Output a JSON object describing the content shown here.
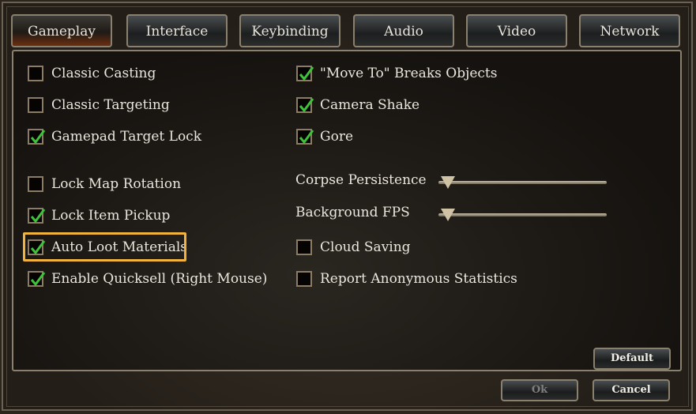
{
  "tabs": [
    {
      "label": "Gameplay",
      "active": true
    },
    {
      "label": "Interface"
    },
    {
      "label": "Keybinding"
    },
    {
      "label": "Audio"
    },
    {
      "label": "Video"
    },
    {
      "label": "Network"
    }
  ],
  "left_options": [
    {
      "label": "Classic Casting",
      "checked": false
    },
    {
      "label": "Classic Targeting",
      "checked": false
    },
    {
      "label": "Gamepad Target Lock",
      "checked": true
    },
    {
      "label": "Lock Map Rotation",
      "checked": false
    },
    {
      "label": "Lock Item Pickup",
      "checked": true
    },
    {
      "label": "Auto Loot Materials",
      "checked": true,
      "highlighted": true
    },
    {
      "label": "Enable Quicksell (Right Mouse)",
      "checked": true
    }
  ],
  "right_options": [
    {
      "label": "\"Move To\" Breaks Objects",
      "checked": true
    },
    {
      "label": "Camera Shake",
      "checked": true
    },
    {
      "label": "Gore",
      "checked": true
    },
    {
      "label": "Cloud Saving",
      "checked": false
    },
    {
      "label": "Report Anonymous Statistics",
      "checked": false
    }
  ],
  "sliders": [
    {
      "label": "Corpse Persistence",
      "value_percent": 0
    },
    {
      "label": "Background FPS",
      "value_percent": 0
    }
  ],
  "buttons": {
    "default": "Default",
    "ok": "Ok",
    "cancel": "Cancel",
    "ok_disabled": true
  },
  "colors": {
    "highlight": "#f2b23e",
    "check": "#3fc23a"
  },
  "icons": {
    "check": "check-mark-icon",
    "slider": "triangle-thumb-icon"
  }
}
